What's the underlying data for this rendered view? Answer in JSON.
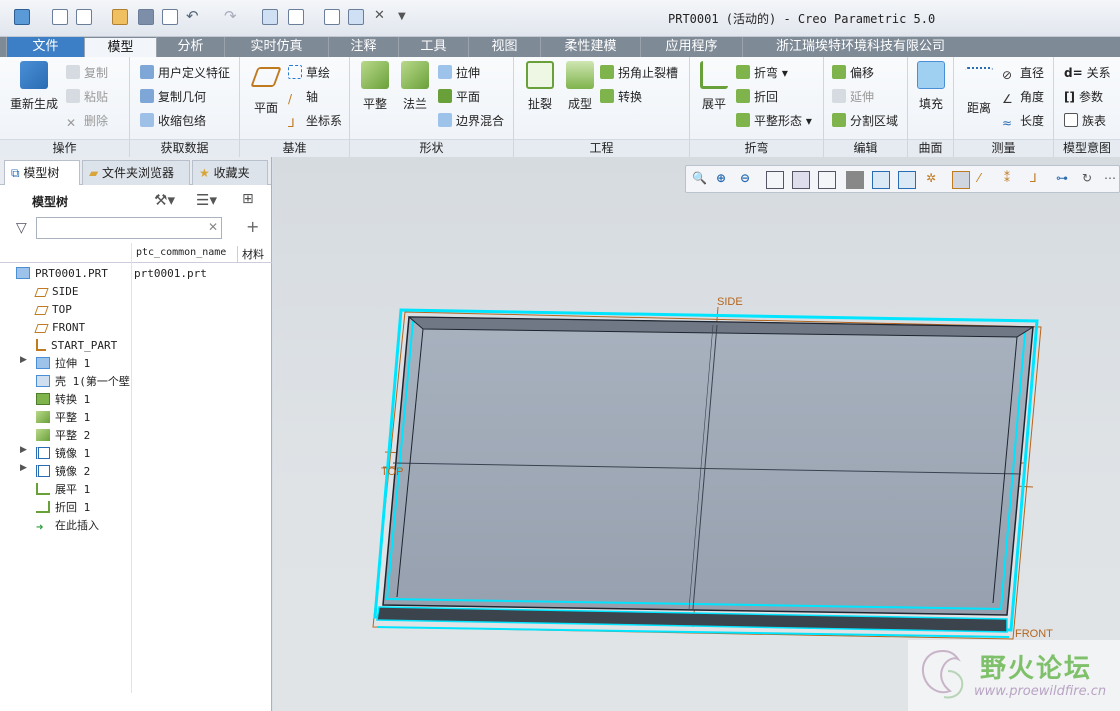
{
  "window": {
    "title": "PRT0001 (活动的) - Creo Parametric 5.0"
  },
  "tabs": [
    "文件",
    "模型",
    "分析",
    "实时仿真",
    "注释",
    "工具",
    "视图",
    "柔性建模",
    "应用程序",
    "浙江瑞埃特环境科技有限公司"
  ],
  "ribbon": {
    "groups": {
      "operations": "操作",
      "get_data": "获取数据",
      "datum": "基准",
      "shapes": "形状",
      "engineering": "工程",
      "bends": "折弯",
      "editing": "编辑",
      "surfaces": "曲面",
      "measure": "测量",
      "model_intent": "模型意图"
    },
    "regenerate": "重新生成",
    "copy": "复制",
    "paste": "粘贴",
    "delete": "删除",
    "user_feature": "用户定义特征",
    "copy_geom": "复制几何",
    "shrinkwrap": "收缩包络",
    "plane": "平面",
    "sketch": "草绘",
    "axis": "轴",
    "csys": "坐标系",
    "flat": "平整",
    "flange": "法兰",
    "extrude": "拉伸",
    "planar": "平面",
    "boundary_blend": "边界混合",
    "rip": "扯裂",
    "form": "成型",
    "corner_relief": "拐角止裂槽",
    "convert": "转换",
    "unbend": "展平",
    "bend": "折弯",
    "bend_back": "折回",
    "flat_state": "平整形态",
    "offset": "偏移",
    "extend": "延伸",
    "split_area": "分割区域",
    "fill": "填充",
    "distance": "距离",
    "diameter": "直径",
    "angle": "角度",
    "length": "长度",
    "relations": "关系",
    "parameters": "参数",
    "family_table": "族表",
    "relations_prefix": "d=",
    "parameters_prefix": "[]"
  },
  "panel": {
    "tabs": [
      "模型树",
      "文件夹浏览器",
      "收藏夹"
    ],
    "tree_title": "模型树",
    "filter_placeholder": "",
    "columns": [
      "ptc_common_name",
      "材料"
    ],
    "root": {
      "label": "PRT0001.PRT",
      "common_name": "prt0001.prt"
    },
    "items": [
      {
        "label": "SIDE",
        "icon": "datum-plane-icon",
        "expand": false
      },
      {
        "label": "TOP",
        "icon": "datum-plane-icon",
        "expand": false
      },
      {
        "label": "FRONT",
        "icon": "datum-plane-icon",
        "expand": false
      },
      {
        "label": "START_PART",
        "icon": "csys-icon",
        "expand": false
      },
      {
        "label": "拉伸 1",
        "icon": "extrude-icon",
        "expand": true
      },
      {
        "label": "壳 1(第一个壁",
        "icon": "shell-icon",
        "expand": false
      },
      {
        "label": "转换 1",
        "icon": "convert-icon",
        "expand": false
      },
      {
        "label": "平整 1",
        "icon": "flat-wall-icon",
        "expand": false
      },
      {
        "label": "平整 2",
        "icon": "flat-wall-icon",
        "expand": false
      },
      {
        "label": "镜像 1",
        "icon": "mirror-icon",
        "expand": true
      },
      {
        "label": "镜像 2",
        "icon": "mirror-icon",
        "expand": true
      },
      {
        "label": "展平 1",
        "icon": "unbend-icon",
        "expand": false
      },
      {
        "label": "折回 1",
        "icon": "bend-back-icon",
        "expand": false
      },
      {
        "label": "在此插入",
        "icon": "insert-here-arrow-icon",
        "expand": false
      }
    ]
  },
  "viewport": {
    "datum_labels": {
      "side": "SIDE",
      "top": "TOP",
      "front": "FRONT"
    },
    "accent": "#00e5ff",
    "datum_color": "#b5651d"
  },
  "watermark": {
    "title": "野火论坛",
    "url": "www.proewildfire.cn"
  }
}
